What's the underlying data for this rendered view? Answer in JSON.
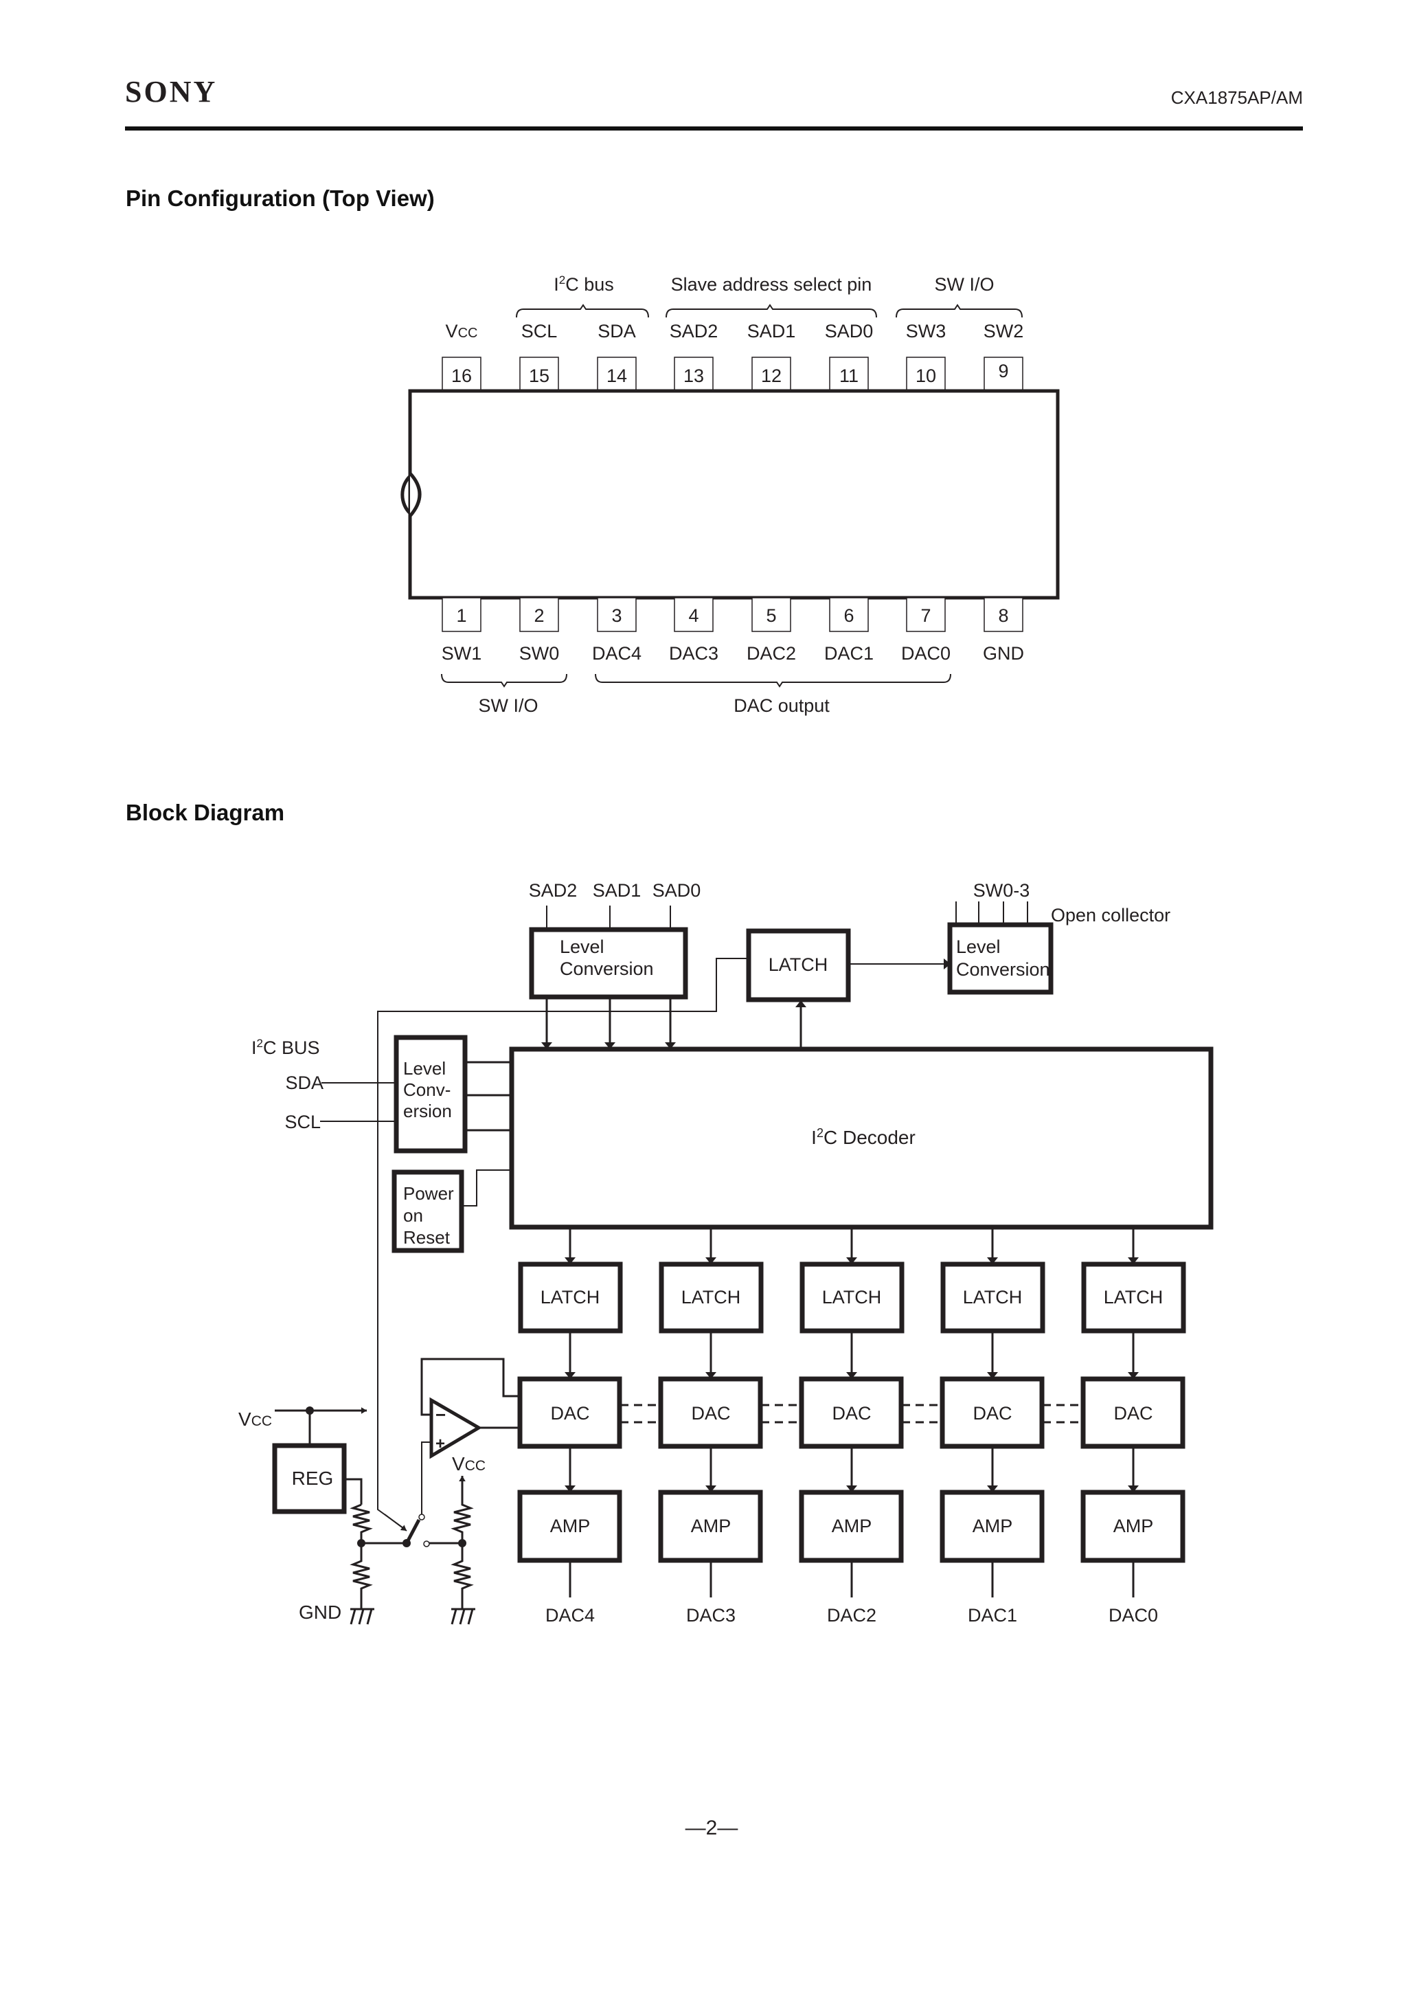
{
  "header": {
    "brand": "SONY",
    "part_number": "CXA1875AP/AM",
    "page_number": "—2—"
  },
  "pin_config": {
    "title": "Pin Configuration (Top View)",
    "top_groups": [
      {
        "label_pre": "I",
        "label_sup": "2",
        "label_post": "C bus"
      },
      {
        "label": "Slave address select pin"
      },
      {
        "label": "SW I/O"
      }
    ],
    "top_pins": [
      {
        "num": "16",
        "name_main": "V",
        "name_sub": "CC"
      },
      {
        "num": "15",
        "name": "SCL"
      },
      {
        "num": "14",
        "name": "SDA"
      },
      {
        "num": "13",
        "name": "SAD2"
      },
      {
        "num": "12",
        "name": "SAD1"
      },
      {
        "num": "11",
        "name": "SAD0"
      },
      {
        "num": "10",
        "name": "SW3"
      },
      {
        "num": "9",
        "name": "SW2"
      }
    ],
    "bottom_pins": [
      {
        "num": "1",
        "name": "SW1"
      },
      {
        "num": "2",
        "name": "SW0"
      },
      {
        "num": "3",
        "name": "DAC4"
      },
      {
        "num": "4",
        "name": "DAC3"
      },
      {
        "num": "5",
        "name": "DAC2"
      },
      {
        "num": "6",
        "name": "DAC1"
      },
      {
        "num": "7",
        "name": "DAC0"
      },
      {
        "num": "8",
        "name": "GND"
      }
    ],
    "bottom_groups": [
      {
        "label": "SW I/O"
      },
      {
        "label": "DAC output"
      }
    ]
  },
  "block_diagram": {
    "title": "Block Diagram",
    "sad_labels": [
      "SAD2",
      "SAD1",
      "SAD0"
    ],
    "sw_label": "SW0-3",
    "open_collector": "Open collector",
    "level_conv_top": [
      "Level",
      "Conversion"
    ],
    "latch_top": "LATCH",
    "level_conv_right": [
      "Level",
      "Conversion"
    ],
    "i2c_bus_label": {
      "pre": "I",
      "sup": "2",
      "post": "C BUS"
    },
    "sda": "SDA",
    "scl": "SCL",
    "level_conv_left": [
      "Level",
      "Conv-",
      "ersion"
    ],
    "power_on_reset": [
      "Power",
      "on",
      "Reset"
    ],
    "decoder": {
      "pre": "I",
      "sup": "2",
      "post": "C Decoder"
    },
    "channels": [
      {
        "latch": "LATCH",
        "dac": "DAC",
        "amp": "AMP",
        "out": "DAC4"
      },
      {
        "latch": "LATCH",
        "dac": "DAC",
        "amp": "AMP",
        "out": "DAC3"
      },
      {
        "latch": "LATCH",
        "dac": "DAC",
        "amp": "AMP",
        "out": "DAC2"
      },
      {
        "latch": "LATCH",
        "dac": "DAC",
        "amp": "AMP",
        "out": "DAC1"
      },
      {
        "latch": "LATCH",
        "dac": "DAC",
        "amp": "AMP",
        "out": "DAC0"
      }
    ],
    "vcc_main": "V",
    "vcc_sub": "CC",
    "reg": "REG",
    "gnd": "GND",
    "opamp_minus": "−",
    "opamp_plus": "+"
  }
}
